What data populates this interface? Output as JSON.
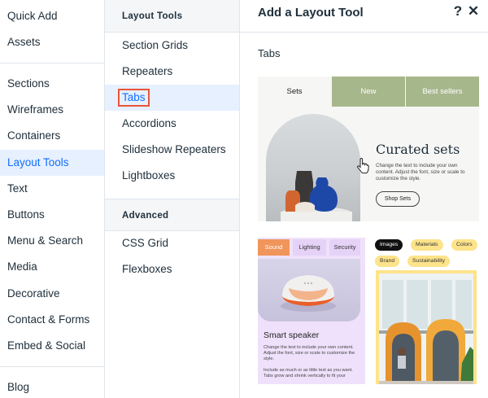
{
  "left_menu": {
    "items": [
      "Quick Add",
      "Assets",
      "Sections",
      "Wireframes",
      "Containers",
      "Layout Tools",
      "Text",
      "Buttons",
      "Menu & Search",
      "Media",
      "Decorative",
      "Contact & Forms",
      "Embed & Social",
      "Blog"
    ],
    "selected": "Layout Tools"
  },
  "middle_menu": {
    "section1_title": "Layout Tools",
    "section1_items": [
      "Section Grids",
      "Repeaters",
      "Tabs",
      "Accordions",
      "Slideshow Repeaters",
      "Lightboxes"
    ],
    "selected": "Tabs",
    "section2_title": "Advanced",
    "section2_items": [
      "CSS Grid",
      "Flexboxes"
    ]
  },
  "panel": {
    "title": "Add a Layout Tool",
    "help_icon": "?",
    "close_icon": "✕",
    "subtitle": "Tabs"
  },
  "card1": {
    "tabs": [
      "Sets",
      "New",
      "Best sellers"
    ],
    "heading": "Curated sets",
    "body": "Change the text to include your own content. Adjust the font, size or scale to customize the style.",
    "button": "Shop Sets"
  },
  "card2": {
    "tabs": [
      "Sound",
      "Lighting",
      "Security"
    ],
    "heading": "Smart speaker",
    "body": "Change the text to include your own content. Adjust the font, size or scale to customize the style.",
    "body2": "Include as much or as little text as you want. Tabs grow and shrink vertically to fit your"
  },
  "card3": {
    "tabs": [
      "Images",
      "Materials",
      "Colors",
      "Brand",
      "Sustainability"
    ]
  },
  "colors": {
    "accent_blue": "#116dff",
    "selected_bg": "#e7f0ff",
    "highlight_border": "#e8553a",
    "sage_tab": "#a7b78c",
    "orange_tab": "#f0955b",
    "lavender": "#efe1fb",
    "yellow": "#fde38a"
  }
}
